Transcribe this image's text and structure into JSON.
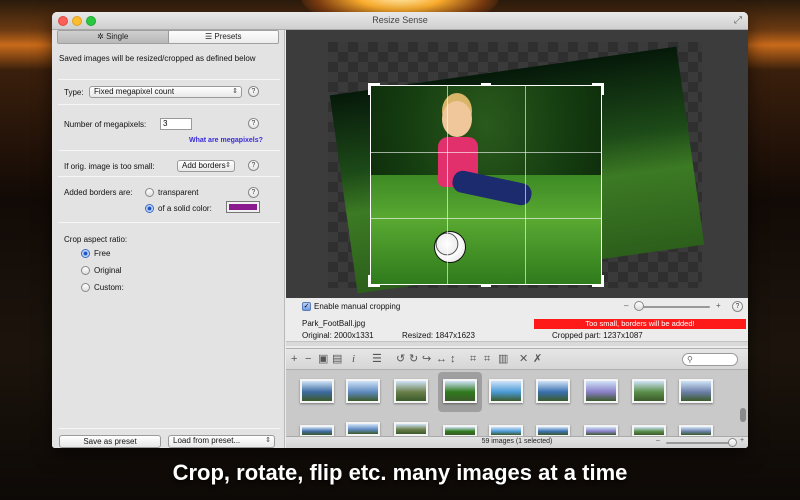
{
  "window": {
    "title": "Resize Sense"
  },
  "tabs": [
    {
      "label": "Single",
      "icon": "gear-icon"
    },
    {
      "label": "Presets",
      "icon": "list-icon"
    }
  ],
  "settings": {
    "description": "Saved images will be resized/cropped as defined below",
    "type_label": "Type:",
    "type_value": "Fixed megapixel count",
    "megapixels_label": "Number of megapixels:",
    "megapixels_value": "3",
    "megapixels_link": "What are megapixels?",
    "too_small_label": "If orig. image is too small:",
    "too_small_value": "Add borders",
    "borders_label": "Added borders are:",
    "border_options": [
      {
        "label": "transparent",
        "selected": false
      },
      {
        "label": "of a solid color:",
        "selected": true
      }
    ],
    "border_color": "#8a1a8e",
    "crop_label": "Crop aspect ratio:",
    "crop_options": [
      {
        "label": "Free",
        "selected": true
      },
      {
        "label": "Original",
        "selected": false
      },
      {
        "label": "Custom:",
        "selected": false
      }
    ],
    "save_preset": "Save as preset",
    "load_preset": "Load from preset..."
  },
  "preview_controls": {
    "enable_cropping_label": "Enable manual cropping",
    "enable_cropping_checked": true,
    "filename": "Park_FootBall.jpg",
    "original": "Original: 2000x1331",
    "resized": "Resized: 1847x1623",
    "cropped": "Cropped part: 1237x1087",
    "warning": "Too small, borders will be added!",
    "zoom_minus": "–",
    "zoom_plus": "+",
    "help": "?"
  },
  "toolbar": {
    "icons": [
      "add-icon",
      "remove-icon",
      "save-icon",
      "save-all-icon",
      "info-icon",
      "list-icon",
      "rotate-left-icon",
      "rotate-right-icon",
      "rotate-icon",
      "flip-horizontal-icon",
      "flip-vertical-icon",
      "crop-icon",
      "crop-all-icon",
      "trash-icon",
      "close-icon",
      "close-all-icon"
    ],
    "search_placeholder": ""
  },
  "status": {
    "text": "59 images (1 selected)"
  },
  "thumb_colors": [
    "#3d6aa0",
    "#5f8ac0",
    "#6a7f4a",
    "#2f7a1c",
    "#4a9ad6",
    "#3a6fae",
    "#8a7fc8",
    "#5a8e4a",
    "#6b7fa8"
  ],
  "caption": "Crop, rotate, flip etc. many images at a time"
}
